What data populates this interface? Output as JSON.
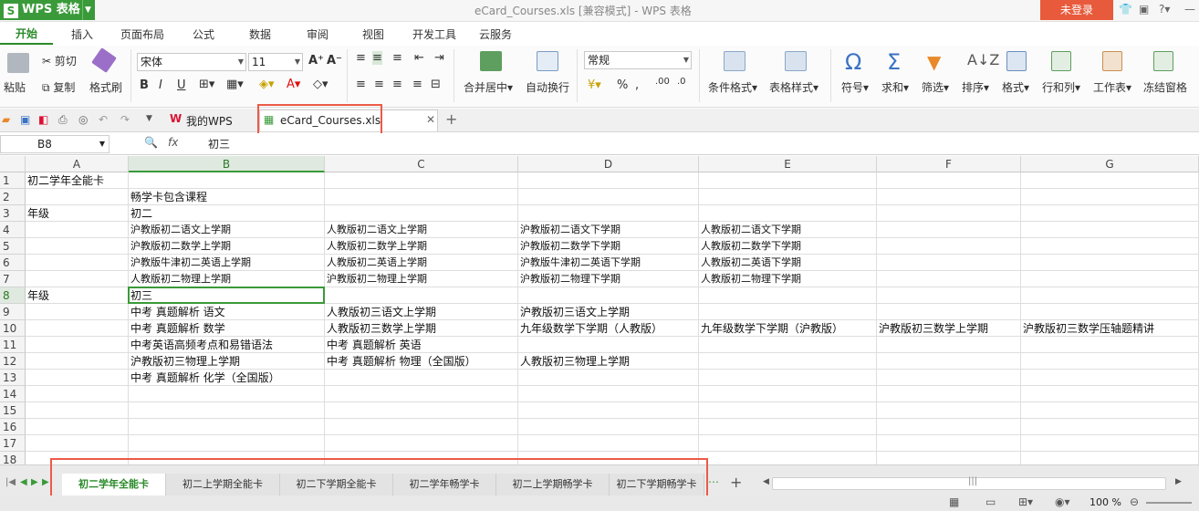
{
  "app": {
    "name": "WPS 表格",
    "logo": "S",
    "login": "未登录",
    "title": "eCard_Courses.xls [兼容模式] - WPS 表格"
  },
  "ribbon_tabs": [
    "开始",
    "插入",
    "页面布局",
    "公式",
    "数据",
    "审阅",
    "视图",
    "开发工具",
    "云服务"
  ],
  "ribbon": {
    "paste": "粘贴",
    "cut": "剪切",
    "copy": "复制",
    "format_painter": "格式刷",
    "font_name": "宋体",
    "font_size": "11",
    "number_format": "常规",
    "merge_center": "合并居中",
    "wrap_text": "自动换行",
    "cond_format": "条件格式",
    "table_style": "表格样式",
    "symbol": "符号",
    "sum": "求和",
    "filter": "筛选",
    "sort": "排序",
    "format": "格式",
    "row_col": "行和列",
    "worksheet": "工作表",
    "freeze": "冻结窗格"
  },
  "filetabs": {
    "home": "我的WPS",
    "file": "eCard_Courses.xls"
  },
  "formula": {
    "cell_ref": "B8",
    "fx": "fx",
    "value": "初三"
  },
  "columns": [
    "A",
    "B",
    "C",
    "D",
    "E",
    "F",
    "G"
  ],
  "rows": [
    "1",
    "2",
    "3",
    "4",
    "5",
    "6",
    "7",
    "8",
    "9",
    "10",
    "11",
    "12",
    "13",
    "14",
    "15",
    "16",
    "17",
    "18"
  ],
  "cells": {
    "r1": {
      "A": "初二学年全能卡"
    },
    "r2": {
      "B": "畅学卡包含课程"
    },
    "r3": {
      "A": "年级",
      "B": "初二"
    },
    "r4": {
      "B": "沪教版初二语文上学期",
      "C": "人教版初二语文上学期",
      "D": "沪教版初二语文下学期",
      "E": "人教版初二语文下学期"
    },
    "r5": {
      "B": "沪教版初二数学上学期",
      "C": "人教版初二数学上学期",
      "D": "沪教版初二数学下学期",
      "E": "人教版初二数学下学期"
    },
    "r6": {
      "B": "沪教版牛津初二英语上学期",
      "C": "人教版初二英语上学期",
      "D": "沪教版牛津初二英语下学期",
      "E": "人教版初二英语下学期"
    },
    "r7": {
      "B": "人教版初二物理上学期",
      "C": "沪教版初二物理上学期",
      "D": "沪教版初二物理下学期",
      "E": "人教版初二物理下学期"
    },
    "r8": {
      "A": "年级",
      "B": "初三"
    },
    "r9": {
      "B": "中考 真题解析 语文",
      "C": "人教版初三语文上学期",
      "D": "沪教版初三语文上学期"
    },
    "r10": {
      "B": "中考 真题解析 数学",
      "C": "人教版初三数学上学期",
      "D": "九年级数学下学期（人教版）",
      "E": "九年级数学下学期（沪教版）",
      "F": "沪教版初三数学上学期",
      "G": "沪教版初三数学压轴题精讲"
    },
    "r11": {
      "B": "中考英语高频考点和易错语法",
      "C": "中考 真题解析 英语"
    },
    "r12": {
      "B": "沪教版初三物理上学期",
      "C": "中考 真题解析 物理（全国版）",
      "D": "人教版初三物理上学期"
    },
    "r13": {
      "B": "中考 真题解析 化学（全国版）"
    }
  },
  "sheets": [
    "初二学年全能卡",
    "初二上学期全能卡",
    "初二下学期全能卡",
    "初二学年畅学卡",
    "初二上学期畅学卡",
    "初二下学期畅学卡"
  ],
  "status": {
    "zoom": "100 %"
  },
  "colors": {
    "accent": "#3a9a3a",
    "highlight": "#ec5a47"
  }
}
